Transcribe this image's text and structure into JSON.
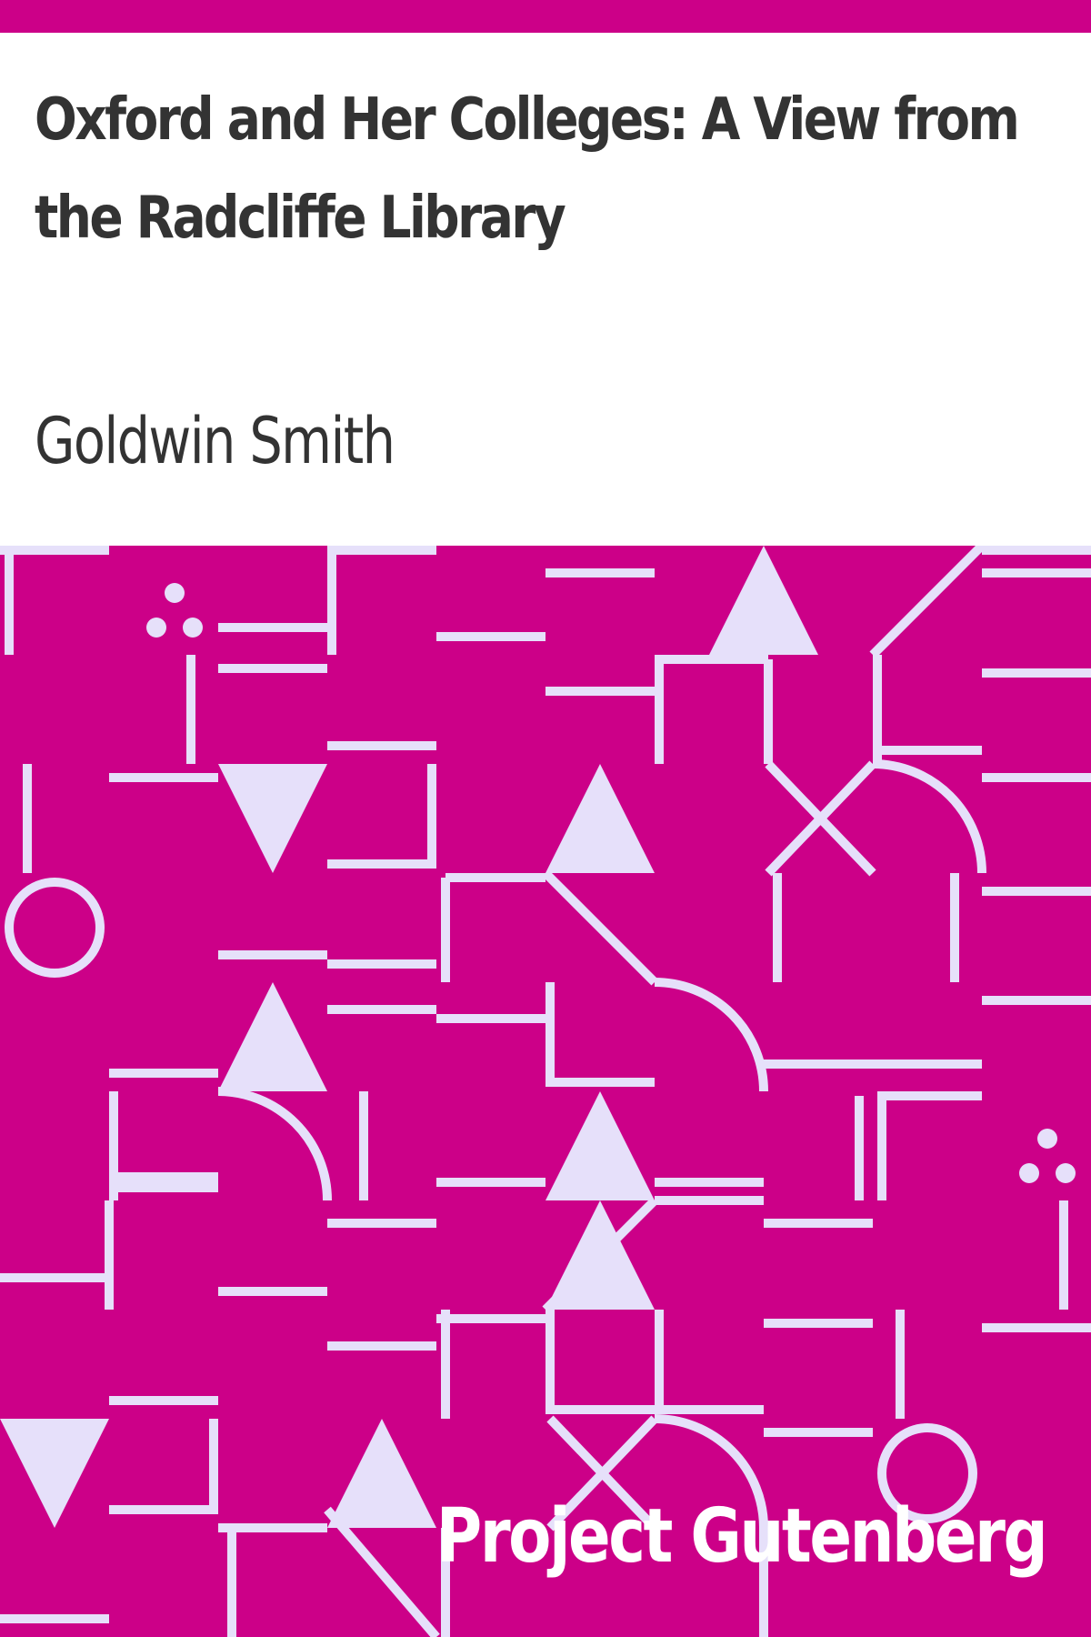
{
  "book": {
    "title": "Oxford and Her Colleges: A View from the Radcliffe Library",
    "author": "Goldwin Smith",
    "publisher": "Project Gutenberg"
  },
  "colors": {
    "accent": "#cc0088",
    "pattern_stroke": "#e6e0fa",
    "text": "#333333"
  }
}
